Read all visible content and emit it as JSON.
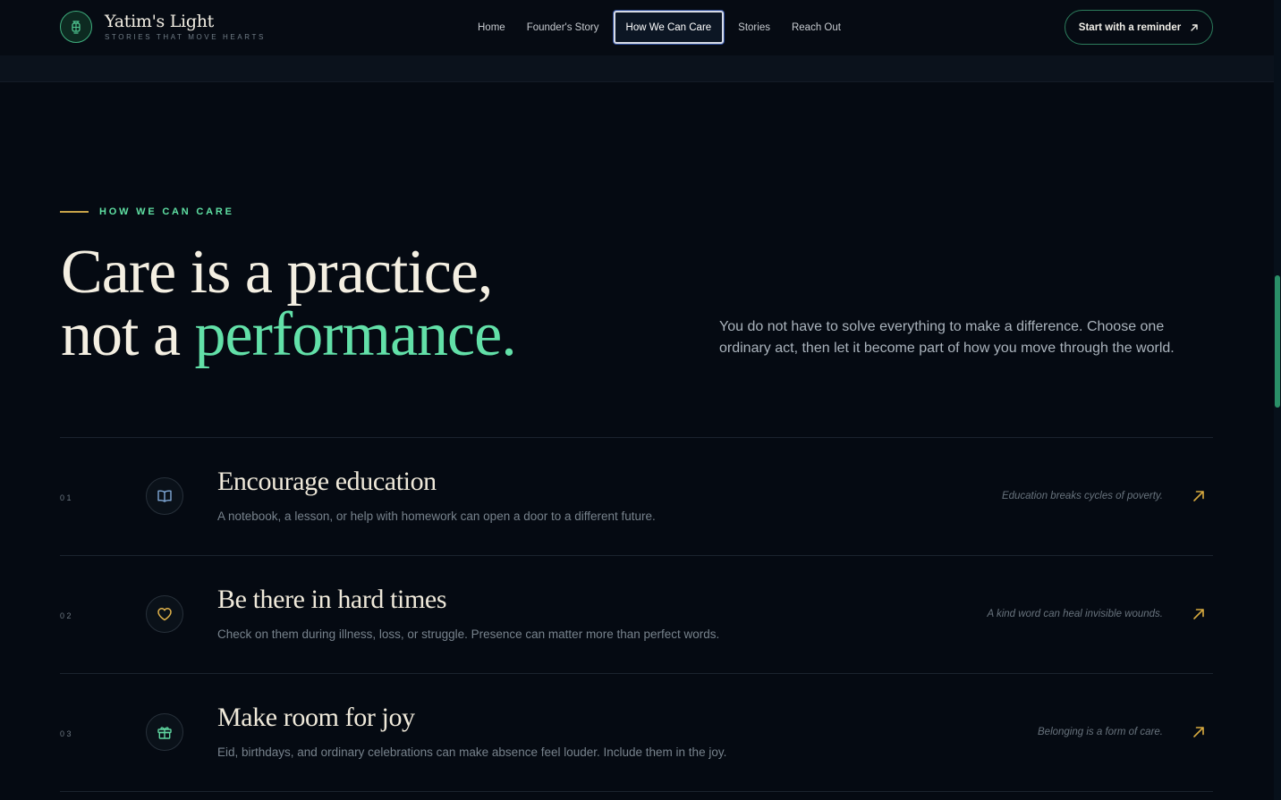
{
  "brand": {
    "name": "Yatim's Light",
    "tagline": "STORIES THAT MOVE HEARTS",
    "logo_icon": "lantern-icon"
  },
  "nav": {
    "items": [
      {
        "label": "Home",
        "active": false
      },
      {
        "label": "Founder's Story",
        "active": false
      },
      {
        "label": "How We Can Care",
        "active": true
      },
      {
        "label": "Stories",
        "active": false
      },
      {
        "label": "Reach Out",
        "active": false
      }
    ]
  },
  "cta": {
    "label": "Start with a reminder",
    "icon": "arrow-up-right-icon"
  },
  "section": {
    "eyebrow": "HOW WE CAN CARE",
    "headline_line1": "Care is a practice,",
    "headline_line2_prefix": "not a ",
    "headline_line2_accent": "performance.",
    "intro": "You do not have to solve everything to make a difference. Choose one ordinary act, then let it become part of how you move through the world."
  },
  "care_items": [
    {
      "number": "01",
      "icon": "book-icon",
      "title": "Encourage education",
      "description": "A notebook, a lesson, or help with homework can open a door to a different future.",
      "quote": "Education breaks cycles of poverty."
    },
    {
      "number": "02",
      "icon": "heart-icon",
      "title": "Be there in hard times",
      "description": "Check on them during illness, loss, or struggle. Presence can matter more than perfect words.",
      "quote": "A kind word can heal invisible wounds."
    },
    {
      "number": "03",
      "icon": "gift-icon",
      "title": "Make room for joy",
      "description": "Eid, birthdays, and ordinary celebrations can make absence feel louder. Include them in the joy.",
      "quote": "Belonging is a form of care."
    }
  ],
  "colors": {
    "background": "#050a12",
    "accent_green": "#62e0a8",
    "accent_gold": "#c7a349",
    "text_primary": "#f4efe2",
    "text_muted": "#77828c"
  }
}
